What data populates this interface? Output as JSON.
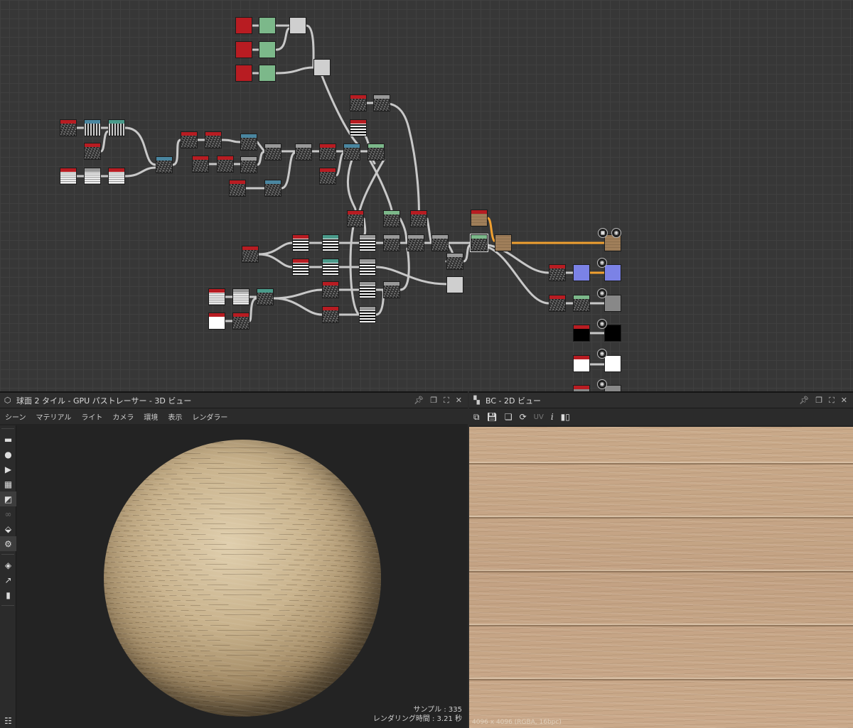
{
  "node_graph": {
    "background": "#373737",
    "wire_color": "#c8c8c8",
    "highlight_wire_color": "#f0a030"
  },
  "panel_3d": {
    "title": "球面 2 タイル - GPU パストレーサー - 3D ビュー",
    "menu": [
      "シーン",
      "マテリアル",
      "ライト",
      "カメラ",
      "環境",
      "表示",
      "レンダラー"
    ],
    "stats_samples": "サンプル : 335",
    "stats_render_time": "レンダリング時間 : 3.21 秒",
    "material_color": "#c9b38d"
  },
  "panel_2d": {
    "title": "BC - 2D ビュー",
    "uv_label": "UV",
    "image_info": "4096 x 4096 (RGBA, 16bpc)",
    "texture_color": "#c5a485"
  }
}
